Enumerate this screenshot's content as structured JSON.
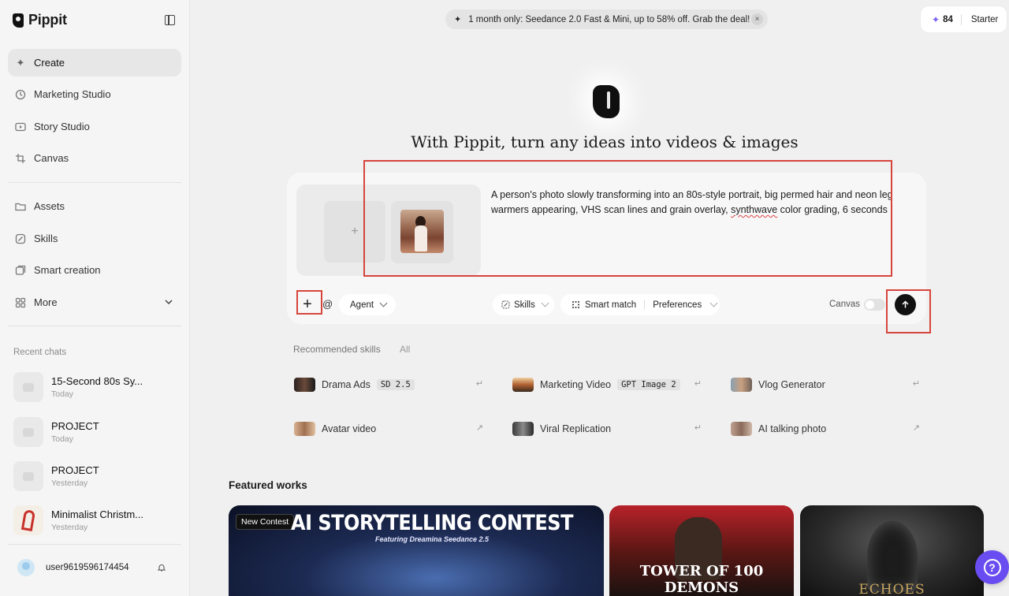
{
  "sidebar": {
    "brand": "Pippit",
    "nav": [
      {
        "label": "Create",
        "icon": "sparkle-icon",
        "active": true
      },
      {
        "label": "Marketing Studio",
        "icon": "marketing-icon"
      },
      {
        "label": "Story Studio",
        "icon": "play-icon"
      },
      {
        "label": "Canvas",
        "icon": "crop-icon"
      }
    ],
    "nav2": [
      {
        "label": "Assets",
        "icon": "folder-icon"
      },
      {
        "label": "Skills",
        "icon": "skills-icon"
      },
      {
        "label": "Smart creation",
        "icon": "smart-creation-icon"
      },
      {
        "label": "More",
        "icon": "grid-icon"
      }
    ],
    "recent_label": "Recent chats",
    "chats": [
      {
        "title": "15-Second 80s Sy...",
        "date": "Today"
      },
      {
        "title": "PROJECT",
        "date": "Today"
      },
      {
        "title": "PROJECT",
        "date": "Yesterday"
      },
      {
        "title": "Minimalist Christm...",
        "date": "Yesterday"
      }
    ],
    "user": "user9619596174454"
  },
  "promo": {
    "text": "1 month only: Seedance 2.0 Fast & Mini, up to 58% off. Grab the deal!",
    "close": "×"
  },
  "credits": {
    "amount": "84",
    "plan": "Starter"
  },
  "hero": {
    "title": "With Pippit, turn any ideas into videos & images"
  },
  "composer": {
    "upload_plus": "+",
    "prompt_before": "A person's photo slowly transforming into an 80s-style portrait, big permed hair and neon leg warmers appearing, VHS scan lines and grain overlay, ",
    "prompt_flag": "synthwave",
    "prompt_after": " color grading, 6 seconds",
    "plus": "+",
    "at": "@",
    "agent": "Agent",
    "skills": "Skills",
    "smart_match": "Smart match",
    "preferences": "Preferences",
    "canvas": "Canvas"
  },
  "recommended": {
    "label": "Recommended skills",
    "all": "All",
    "items": [
      {
        "name": "Drama Ads",
        "tag": "SD 2.5",
        "arrow": "↵"
      },
      {
        "name": "Marketing Video",
        "tag": "GPT Image 2",
        "arrow": "↵"
      },
      {
        "name": "Vlog Generator",
        "tag": "",
        "arrow": "↵"
      },
      {
        "name": "Avatar video",
        "tag": "",
        "arrow": "↗"
      },
      {
        "name": "Viral Replication",
        "tag": "",
        "arrow": "↵"
      },
      {
        "name": "AI talking photo",
        "tag": "",
        "arrow": "↗"
      }
    ]
  },
  "featured": {
    "title": "Featured works",
    "badge": "New Contest",
    "contest_title": "AI STORYTELLING CONTEST",
    "contest_sub": "Featuring Dreamina Seedance 2.5",
    "poster2": "TOWER OF 100 DEMONS",
    "poster3": "ECHOES"
  },
  "help": "?"
}
